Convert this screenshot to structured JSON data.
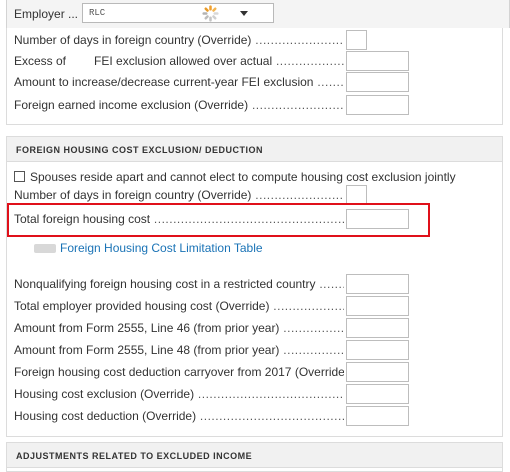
{
  "employer": {
    "label": "Employer ...",
    "selected_value": "RLC",
    "icons": [
      "loading-spinner-icon",
      "chevron-down-icon"
    ]
  },
  "top_panel": {
    "rows": [
      {
        "label": "Number of days in foreign country (Override)",
        "field": "small",
        "value": ""
      },
      {
        "label_prefix": "Excess of",
        "label_suffix": "FEI exclusion allowed over actual",
        "field": "wide",
        "value": ""
      },
      {
        "label": "Amount to increase/decrease current-year FEI exclusion",
        "field": "wide",
        "value": ""
      },
      {
        "label": "Foreign earned income exclusion (Override)",
        "field": "wide",
        "value": ""
      }
    ]
  },
  "housing": {
    "header": "FOREIGN HOUSING COST EXCLUSION/ DEDUCTION",
    "checkbox_label": "Spouses reside apart and cannot elect to compute housing cost exclusion jointly",
    "checkbox_checked": false,
    "days_label": "Number of days in foreign country (Override)",
    "total_cost_label": "Total foreign housing cost",
    "link_label": "Foreign Housing Cost Limitation Table",
    "rows": [
      {
        "label": "Nonqualifying foreign housing cost in a restricted country",
        "value": ""
      },
      {
        "label": "Total employer provided housing cost (Override)",
        "value": ""
      },
      {
        "label": "Amount from Form 2555, Line 46 (from prior year)",
        "value": ""
      },
      {
        "label": "Amount from Form 2555, Line 48 (from prior year)",
        "value": ""
      },
      {
        "label": "Foreign housing cost deduction carryover from 2017 (Override)",
        "value": ""
      },
      {
        "label": "Housing cost exclusion (Override)",
        "value": ""
      },
      {
        "label": "Housing cost deduction (Override)",
        "value": ""
      }
    ]
  },
  "adjustments": {
    "header": "ADJUSTMENTS RELATED TO EXCLUDED INCOME"
  },
  "colors": {
    "highlight": "#e0101a",
    "link": "#1a73b6",
    "header_bg": "#f1f1f1"
  }
}
